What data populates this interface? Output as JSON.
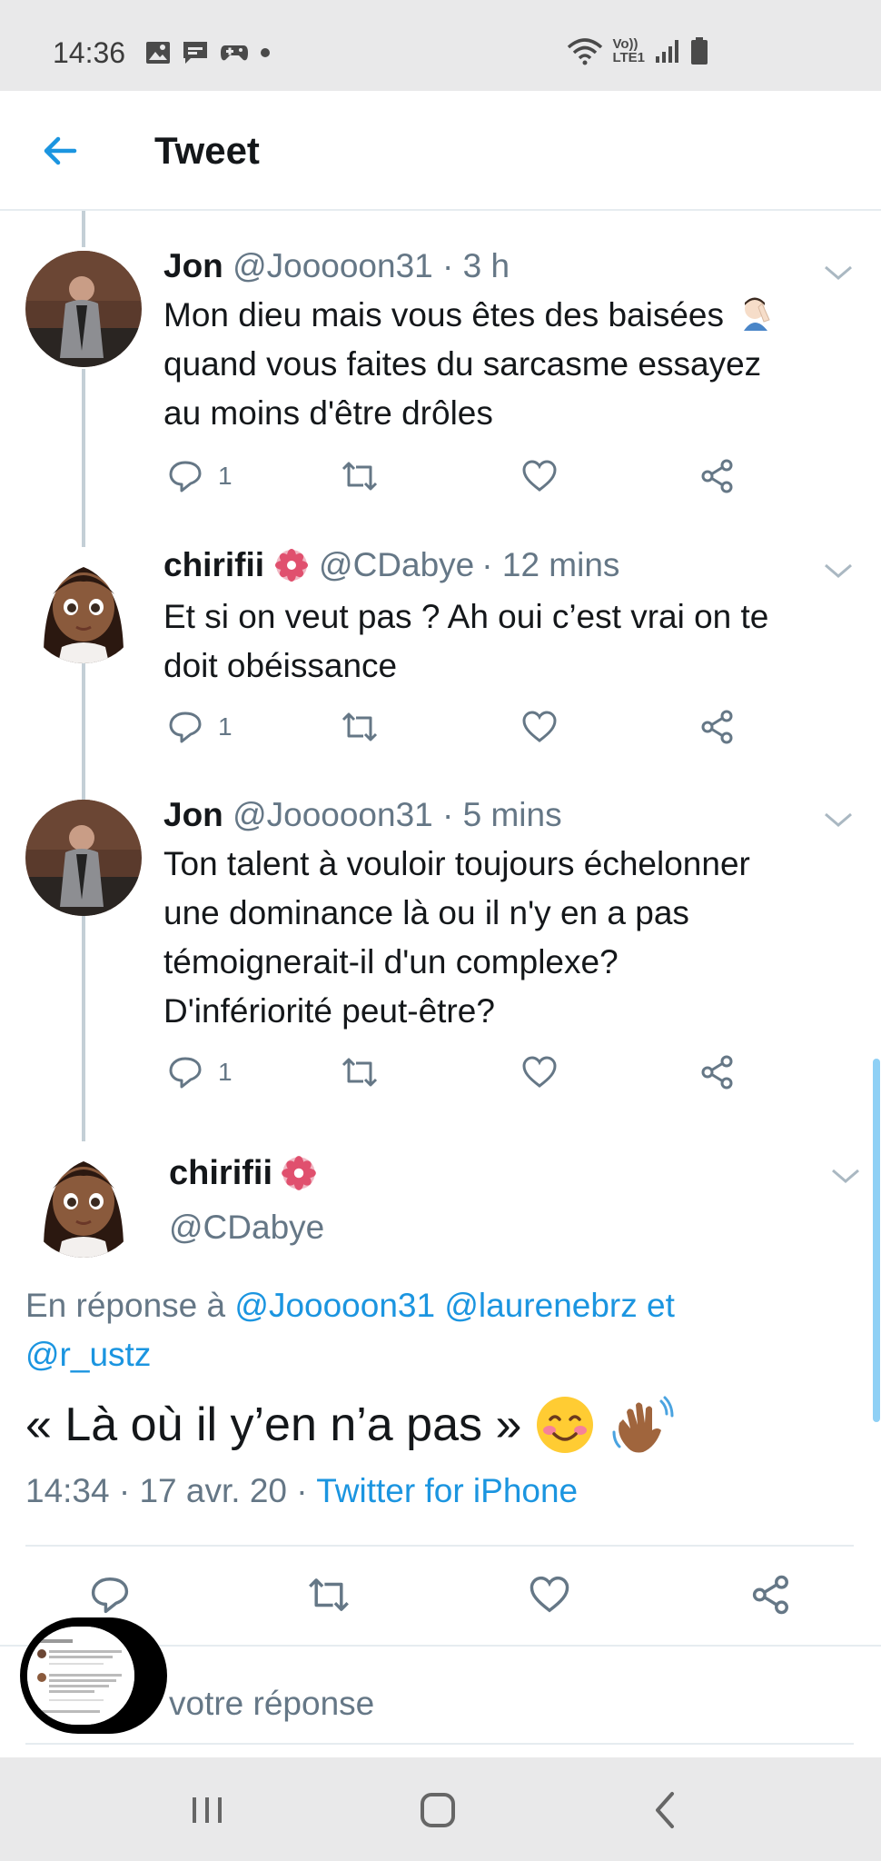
{
  "status_bar": {
    "time": "14:36",
    "left_icons": [
      "image-icon",
      "message-icon",
      "game-controller-icon",
      "dot-icon"
    ],
    "right_icons": [
      "wifi-icon",
      "volte-icon",
      "signal-icon",
      "battery-icon"
    ],
    "volte_label": "Vo))",
    "lte_label": "LTE1"
  },
  "header": {
    "title": "Tweet",
    "back_icon": "arrow-left-icon"
  },
  "colors": {
    "accent": "#1b95e0",
    "secondary_text": "#657786",
    "thread_line": "#c4cfd6"
  },
  "tweets": [
    {
      "name": "Jon",
      "handle": "@Jooooon31",
      "time": "· 3 h",
      "text": "Mon dieu mais vous êtes des baisées",
      "text_line2": "quand vous faites du sarcasme essayez",
      "text_line3": "au moins d'être drôles",
      "emoji": "facepalm-emoji",
      "reply_count": "1"
    },
    {
      "name": "chirifii",
      "handle": "@CDabye",
      "time": "· 12 mins",
      "badge": "flower-icon",
      "text": "Et si on veut pas ? Ah oui c’est vrai on te",
      "text_line2": "doit obéissance",
      "reply_count": "1"
    },
    {
      "name": "Jon",
      "handle": "@Jooooon31",
      "time": "· 5 mins",
      "text": "Ton talent à vouloir toujours échelonner",
      "text_line2": "une dominance là ou il n'y en a pas",
      "text_line3": "témoignerait-il d'un complexe?",
      "text_line4": "D'infériorité peut-être?",
      "reply_count": "1"
    }
  ],
  "main_tweet": {
    "name": "chirifii",
    "handle": "@CDabye",
    "reply_prefix": "En réponse à",
    "reply_users": [
      "@Jooooon31",
      "@laurenebrz"
    ],
    "reply_and": "et",
    "reply_last": "@r_ustz",
    "text": "« Là où il y’en n’a pas »",
    "emojis": [
      "smiling-face-emoji",
      "waving-hand-emoji"
    ],
    "timestamp": "14:34 · 17 avr. 20 ·",
    "source": "Twitter for iPhone"
  },
  "reply_bar": {
    "placeholder": "votre réponse"
  },
  "nav_bar": {
    "buttons": [
      "recents-icon",
      "home-icon",
      "back-icon"
    ]
  }
}
